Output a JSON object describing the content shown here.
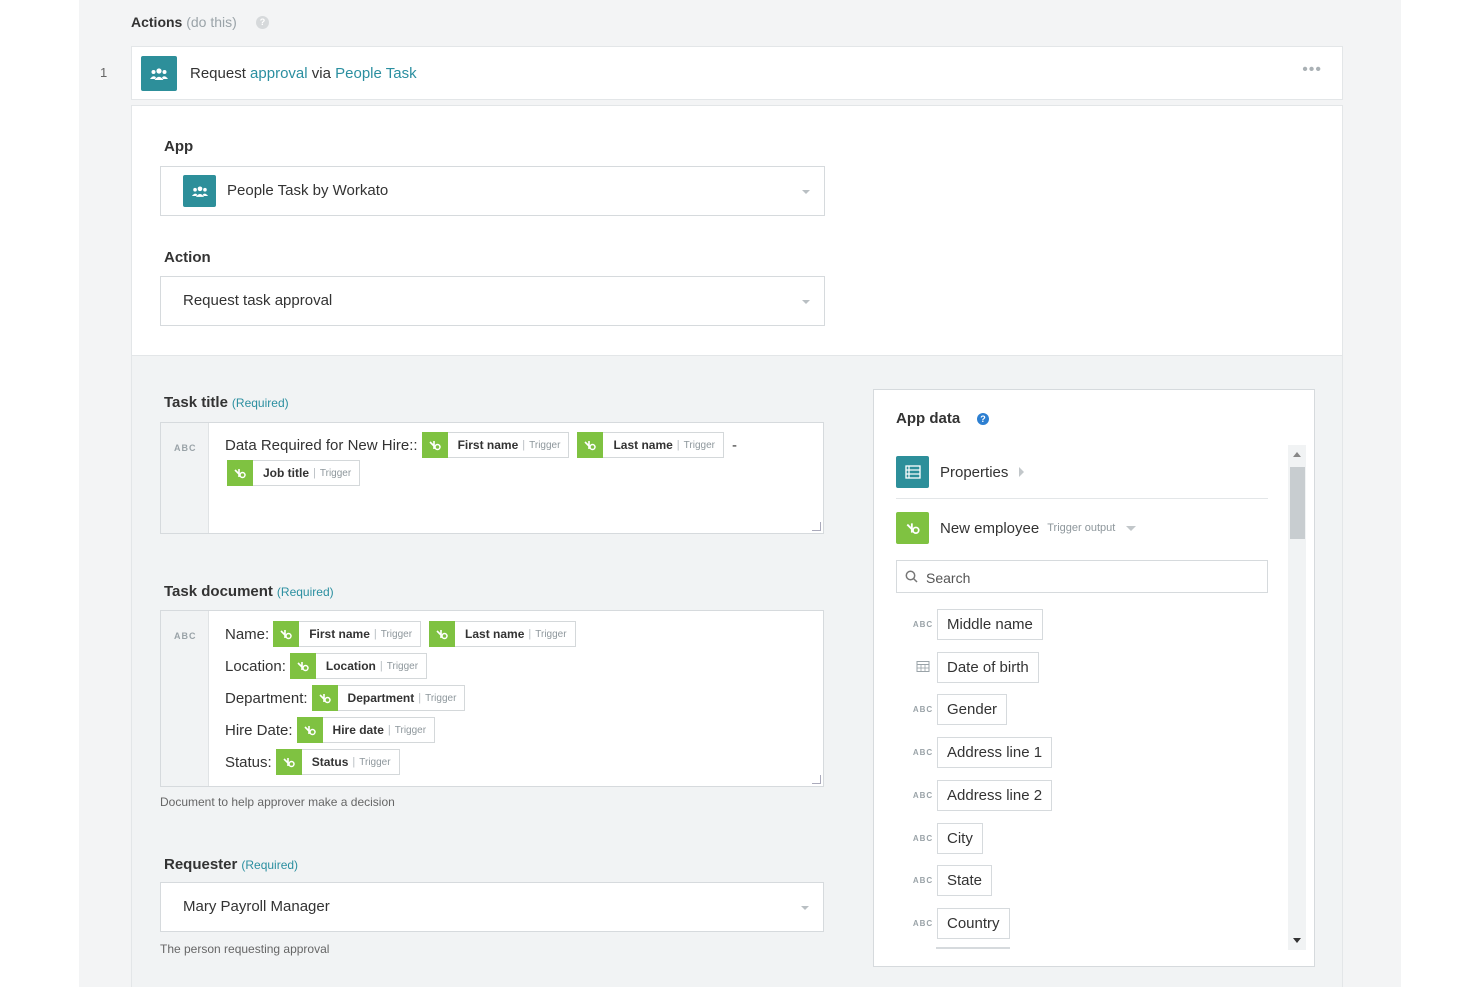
{
  "section": {
    "title": "Actions",
    "subtitle": "(do this)",
    "help": "?"
  },
  "step": {
    "number": "1",
    "prefix": "Request",
    "link1": "approval",
    "middle": "via",
    "link2": "People Task",
    "more": "•••"
  },
  "app_field": {
    "label": "App",
    "value": "People Task by Workato"
  },
  "action_field": {
    "label": "Action",
    "value": "Request task approval"
  },
  "task_title": {
    "label": "Task title",
    "required": "(Required)",
    "abc": "ABC",
    "line1_text": "Data Required for New Hire::",
    "pill_first": {
      "name": "First name",
      "source": "Trigger"
    },
    "pill_last": {
      "name": "Last name",
      "source": "Trigger"
    },
    "dash": "-",
    "pill_job": {
      "name": "Job title",
      "source": "Trigger"
    }
  },
  "task_document": {
    "label": "Task document",
    "required": "(Required)",
    "abc": "ABC",
    "rows": [
      {
        "label": "Name:",
        "pills": [
          {
            "name": "First name",
            "source": "Trigger"
          },
          {
            "name": "Last name",
            "source": "Trigger"
          }
        ]
      },
      {
        "label": "Location:",
        "pills": [
          {
            "name": "Location",
            "source": "Trigger"
          }
        ]
      },
      {
        "label": "Department:",
        "pills": [
          {
            "name": "Department",
            "source": "Trigger"
          }
        ]
      },
      {
        "label": "Hire Date:",
        "pills": [
          {
            "name": "Hire date",
            "source": "Trigger"
          }
        ]
      },
      {
        "label": "Status:",
        "pills": [
          {
            "name": "Status",
            "source": "Trigger"
          }
        ]
      }
    ],
    "hint": "Document to help approver make a decision"
  },
  "requester": {
    "label": "Requester",
    "required": "(Required)",
    "value": "Mary Payroll Manager",
    "hint": "The person requesting approval"
  },
  "app_data": {
    "title": "App data",
    "help": "?",
    "properties": "Properties",
    "trigger_name": "New employee",
    "trigger_tag": "Trigger output",
    "search_placeholder": "Search",
    "fields": [
      {
        "type": "ABC",
        "name": "Middle name"
      },
      {
        "type": "calendar",
        "name": "Date of birth"
      },
      {
        "type": "ABC",
        "name": "Gender"
      },
      {
        "type": "ABC",
        "name": "Address line 1"
      },
      {
        "type": "ABC",
        "name": "Address line 2"
      },
      {
        "type": "ABC",
        "name": "City"
      },
      {
        "type": "ABC",
        "name": "State"
      },
      {
        "type": "ABC",
        "name": "Country"
      }
    ]
  },
  "colors": {
    "teal": "#2d8f9a",
    "green": "#7fc241",
    "link": "#2b8fa0",
    "help_blue": "#2d7fd1"
  }
}
